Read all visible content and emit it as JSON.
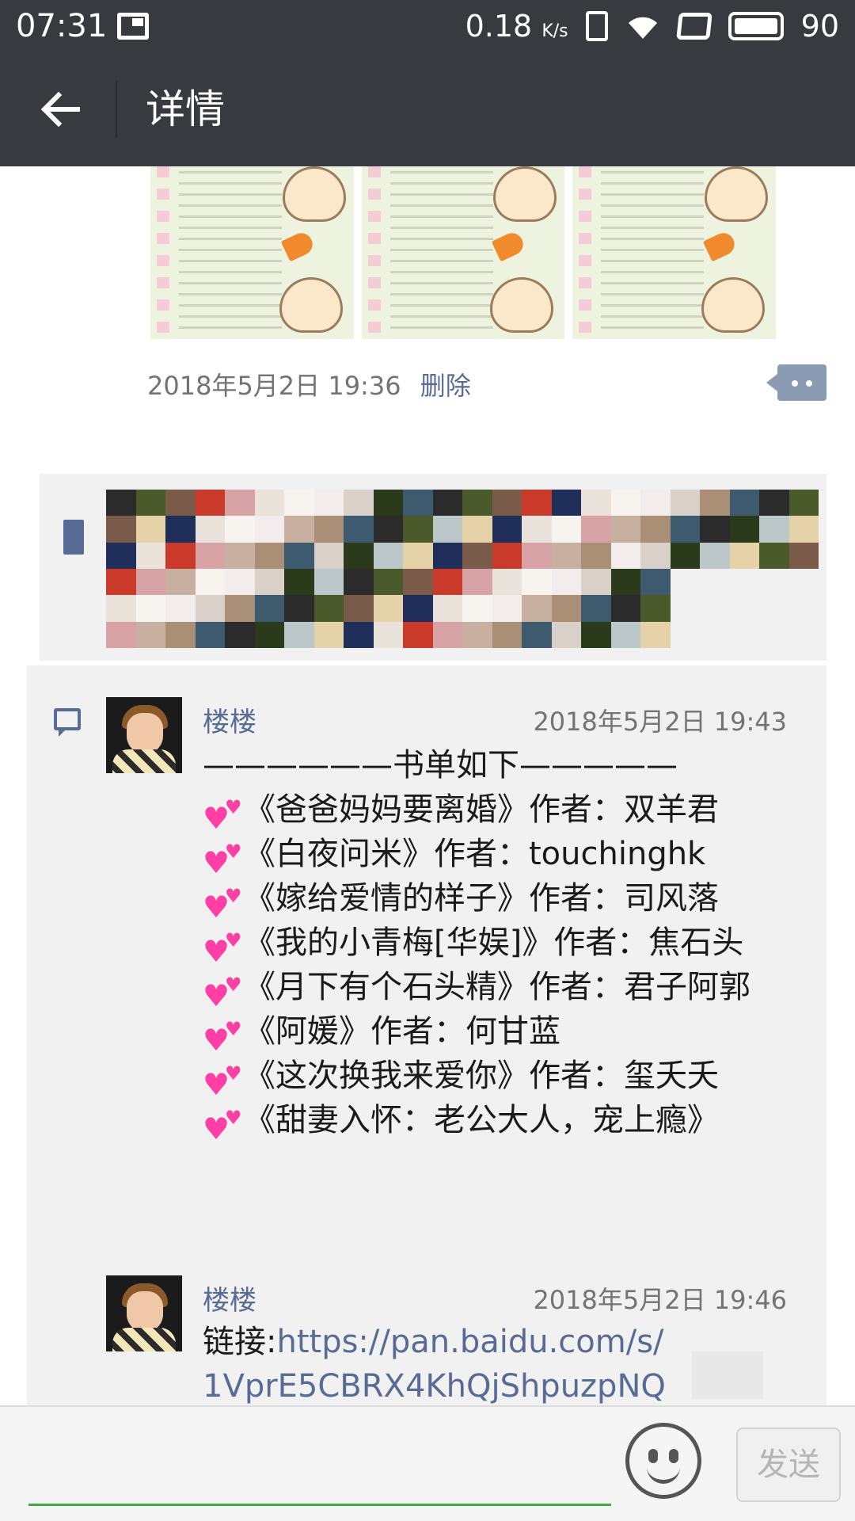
{
  "status_bar": {
    "time": "07:31",
    "net_speed": "0.18",
    "net_unit": "K/s",
    "battery": "90"
  },
  "header": {
    "title": "详情"
  },
  "post": {
    "timestamp": "2018年5月2日 19:36",
    "delete_label": "删除"
  },
  "comments": [
    {
      "name": "楼楼",
      "time": "2018年5月2日 19:43",
      "intro": "——————书单如下—————",
      "books": [
        "《爸爸妈妈要离婚》作者：双羊君",
        "《白夜问米》作者：touchinghk",
        "《嫁给爱情的样子》作者：司风落",
        "《我的小青梅[华娱]》作者：焦石头",
        "《月下有个石头精》作者：君子阿郭",
        "《阿媛》作者：何甘蓝",
        "《这次换我来爱你》作者：玺夭夭",
        "《甜妻入怀：老公大人，宠上瘾》"
      ]
    },
    {
      "name": "楼楼",
      "time": "2018年5月2日 19:46",
      "link_prefix": "链接:",
      "link_line1": "https://pan.baidu.com/s/",
      "link_line2": "1VprE5CBRX4KhQjShpuzpNQ"
    }
  ],
  "input_bar": {
    "send_label": "发送"
  },
  "colors": {
    "header_bg": "#393a3f",
    "link_blue": "#576b95",
    "meta_gray": "#737373",
    "heart_pink": "#ff3fa4",
    "input_green": "#3fae3f"
  }
}
